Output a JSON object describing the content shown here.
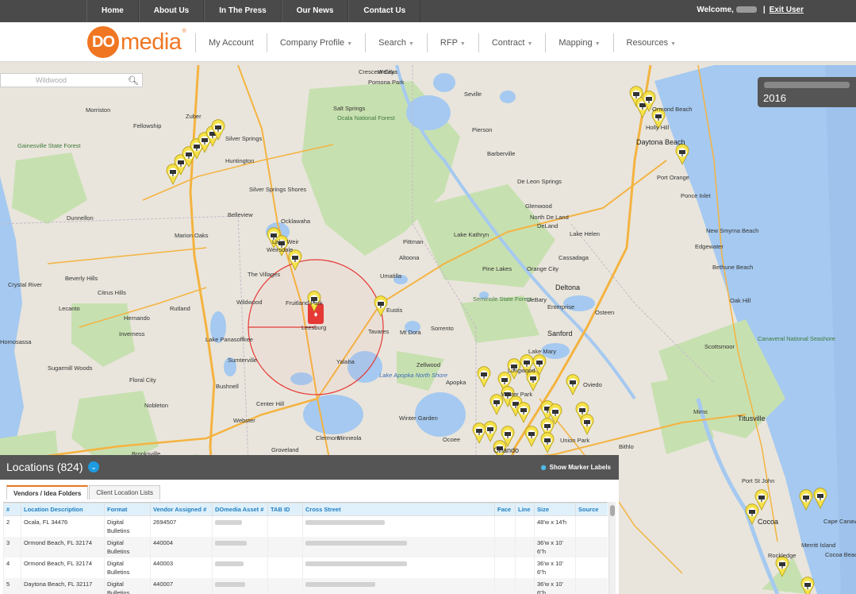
{
  "topnav": {
    "items": [
      "Home",
      "About Us",
      "In The Press",
      "Our News",
      "Contact Us"
    ],
    "welcome": "Welcome,",
    "exit": "Exit User"
  },
  "logo": {
    "mark": "DO",
    "word": "media",
    "reg": "®"
  },
  "mainnav": {
    "items": [
      {
        "label": "My Account",
        "dropdown": false
      },
      {
        "label": "Company Profile",
        "dropdown": true
      },
      {
        "label": "Search",
        "dropdown": true
      },
      {
        "label": "RFP",
        "dropdown": true
      },
      {
        "label": "Contract",
        "dropdown": true
      },
      {
        "label": "Mapping",
        "dropdown": true
      },
      {
        "label": "Resources",
        "dropdown": true
      }
    ]
  },
  "map": {
    "search_placeholder": "Wildwood",
    "event_year": "2016",
    "places": [
      "Morriston",
      "Fellowship",
      "Zuber",
      "Silver Springs",
      "Huntington",
      "Gainesville State Forest",
      "Dunnellon",
      "Belleview",
      "Silver Springs Shores",
      "Marion Oaks",
      "Ocklawaha",
      "Weirsdale",
      "Beverly Hills",
      "Citrus Hills",
      "Crystal River",
      "Lecanto",
      "Hernando",
      "Floral City",
      "Inverness",
      "Rutland",
      "Wildwood",
      "The Villages",
      "Fruitland Park",
      "Leesburg",
      "Tavares",
      "Eustis",
      "Sorrento",
      "Mt Dora",
      "Yalaha",
      "Zellwood",
      "Apopka",
      "Ocoee",
      "Winter Garden",
      "Clermont",
      "Minneola",
      "Groveland",
      "Center Hill",
      "Webster",
      "Nobleton",
      "Bushnell",
      "Sumterville",
      "Lake Panasoffkee",
      "Sugarmill Woods",
      "Homosassa",
      "Brooksville",
      "Ocala National Forest",
      "Crescent City",
      "Pomona Park",
      "Welaka",
      "Salt Springs",
      "Altoona",
      "Umatilla",
      "Pittman",
      "Lake Kathryn",
      "Pine Lakes",
      "Cassadaga",
      "Deltona",
      "Sanford",
      "DeBary",
      "Osteen",
      "Lake Mary",
      "Longwood",
      "Oviedo",
      "Winter Park",
      "Orlando",
      "Seville",
      "Barberville",
      "Pierson",
      "De Leon Springs",
      "Glenwood",
      "DeLand",
      "North De Land",
      "Lake Helen",
      "Orange City",
      "Enterprise",
      "Edgewater",
      "New Smyrna Beach",
      "Port Orange",
      "Daytona Beach",
      "Holly Hill",
      "Ormond Beach",
      "Ponce Inlet",
      "Oak Hill",
      "Mims",
      "Titusville",
      "Port St John",
      "Cocoa",
      "Rockledge",
      "Merritt Island",
      "Cape Canaveral",
      "Cocoa Beach",
      "Bithlo",
      "Canaveral National Seashore",
      "Seminole State Forest",
      "Lake Apopka North Shore",
      "Bethune Beach",
      "Scottsmoor",
      "Union Park",
      "Lake Weir"
    ]
  },
  "locations": {
    "title": "Locations (824)",
    "show_labels": "Show Marker Labels",
    "tabs": [
      "Vendors / Idea Folders",
      "Client Location Lists"
    ],
    "columns": [
      "#",
      "Location Description",
      "Format",
      "Vendor Assigned #",
      "DOmedia Asset #",
      "TAB ID",
      "Cross Street",
      "Face",
      "Line",
      "Size",
      "Source"
    ],
    "rows": [
      {
        "num": "2",
        "desc": "Ocala, FL 34476",
        "format": "Digital Bulletins",
        "vendor": "2694507",
        "size": "48'w x 14'h"
      },
      {
        "num": "3",
        "desc": "Ormond Beach, FL 32174",
        "format": "Digital Bulletins",
        "vendor": "440004",
        "size": "36'w x 10' 6\"h"
      },
      {
        "num": "4",
        "desc": "Ormond Beach, FL 32174",
        "format": "Digital Bulletins",
        "vendor": "440003",
        "size": "36'w x 10' 6\"h"
      },
      {
        "num": "5",
        "desc": "Daytona Beach, FL 32117",
        "format": "Digital Bulletins",
        "vendor": "440007",
        "size": "36'w x 10' 6\"h"
      }
    ]
  },
  "colors": {
    "accent": "#f07622",
    "topbar": "#4a4a4a",
    "panel_header": "#555555",
    "link": "#1f7fc1",
    "water": "#a5c9f0",
    "forest": "#c7e0b0"
  }
}
